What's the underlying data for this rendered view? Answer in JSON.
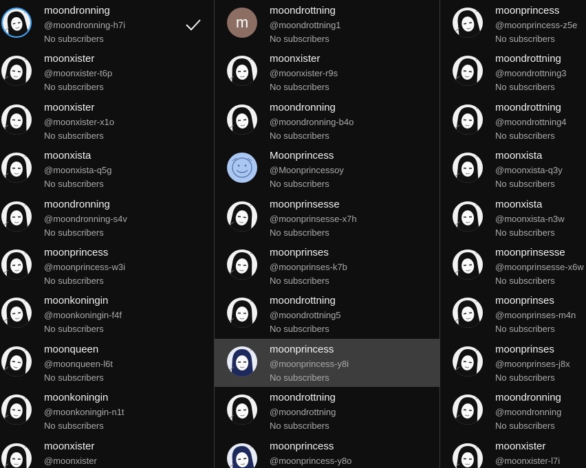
{
  "accounts": {
    "subscribers_text": "No subscribers",
    "columns": [
      [
        {
          "name": "moondronning",
          "handle": "@moondronning-h7i",
          "avatar": "manga-portrait",
          "current": true
        },
        {
          "name": "moonxister",
          "handle": "@moonxister-t6p",
          "avatar": "manga-portrait"
        },
        {
          "name": "moonxister",
          "handle": "@moonxister-x1o",
          "avatar": "manga-portrait"
        },
        {
          "name": "moonxista",
          "handle": "@moonxista-q5g",
          "avatar": "manga-portrait"
        },
        {
          "name": "moondronning",
          "handle": "@moondronning-s4v",
          "avatar": "manga-portrait"
        },
        {
          "name": "moonprincess",
          "handle": "@moonprincess-w3i",
          "avatar": "manga-portrait"
        },
        {
          "name": "moonkoningin",
          "handle": "@moonkoningin-f4f",
          "avatar": "manga-portrait"
        },
        {
          "name": "moonqueen",
          "handle": "@moonqueen-l6t",
          "avatar": "manga-portrait"
        },
        {
          "name": "moonkoningin",
          "handle": "@moonkoningin-n1t",
          "avatar": "manga-portrait"
        },
        {
          "name": "moonxister",
          "handle": "@moonxister",
          "avatar": "manga-portrait"
        }
      ],
      [
        {
          "name": "moondrottning",
          "handle": "@moondrottning1",
          "avatar": "letter",
          "letter": "m",
          "color": "#8d6e63"
        },
        {
          "name": "moonxister",
          "handle": "@moonxister-r9s",
          "avatar": "manga-portrait"
        },
        {
          "name": "moondronning",
          "handle": "@moondronning-b4o",
          "avatar": "manga-portrait"
        },
        {
          "name": "Moonprincess",
          "handle": "@Moonprincessoy",
          "avatar": "blue-sketch",
          "color": "#a9c7f0"
        },
        {
          "name": "moonprinsesse",
          "handle": "@moonprinsesse-x7h",
          "avatar": "manga-portrait"
        },
        {
          "name": "moonprinses",
          "handle": "@moonprinses-k7b",
          "avatar": "manga-portrait"
        },
        {
          "name": "moondrottning",
          "handle": "@moondrottning5",
          "avatar": "manga-portrait"
        },
        {
          "name": "moonprincess",
          "handle": "@moonprincess-y8i",
          "avatar": "manga-portrait-blue",
          "color": "#1f2a5c",
          "hovered": true
        },
        {
          "name": "moondrottning",
          "handle": "@moondrottning",
          "avatar": "manga-portrait"
        },
        {
          "name": "moonprincess",
          "handle": "@moonprincess-y8o",
          "avatar": "manga-portrait-blue",
          "color": "#1f2a5c"
        }
      ],
      [
        {
          "name": "moonprincess",
          "handle": "@moonprincess-z5e",
          "avatar": "manga-portrait"
        },
        {
          "name": "moondrottning",
          "handle": "@moondrottning3",
          "avatar": "manga-portrait"
        },
        {
          "name": "moondrottning",
          "handle": "@moondrottning4",
          "avatar": "manga-portrait"
        },
        {
          "name": "moonxista",
          "handle": "@moonxista-q3y",
          "avatar": "manga-portrait"
        },
        {
          "name": "moonxista",
          "handle": "@moonxista-n3w",
          "avatar": "manga-portrait"
        },
        {
          "name": "moonprinsesse",
          "handle": "@moonprinsesse-x6w",
          "avatar": "manga-portrait"
        },
        {
          "name": "moonprinses",
          "handle": "@moonprinses-m4n",
          "avatar": "manga-portrait"
        },
        {
          "name": "moonprinses",
          "handle": "@moonprinses-j8x",
          "avatar": "manga-portrait"
        },
        {
          "name": "moondronning",
          "handle": "@moondronning",
          "avatar": "manga-portrait"
        },
        {
          "name": "moonxister",
          "handle": "@moonxister-l7i",
          "avatar": "manga-portrait"
        }
      ]
    ]
  },
  "icons": {
    "selected": "checkmark-icon"
  },
  "colors": {
    "current_ring": "#3ea6ff",
    "hover_bg": "#3d3d3d",
    "background": "#0f0f0f"
  }
}
